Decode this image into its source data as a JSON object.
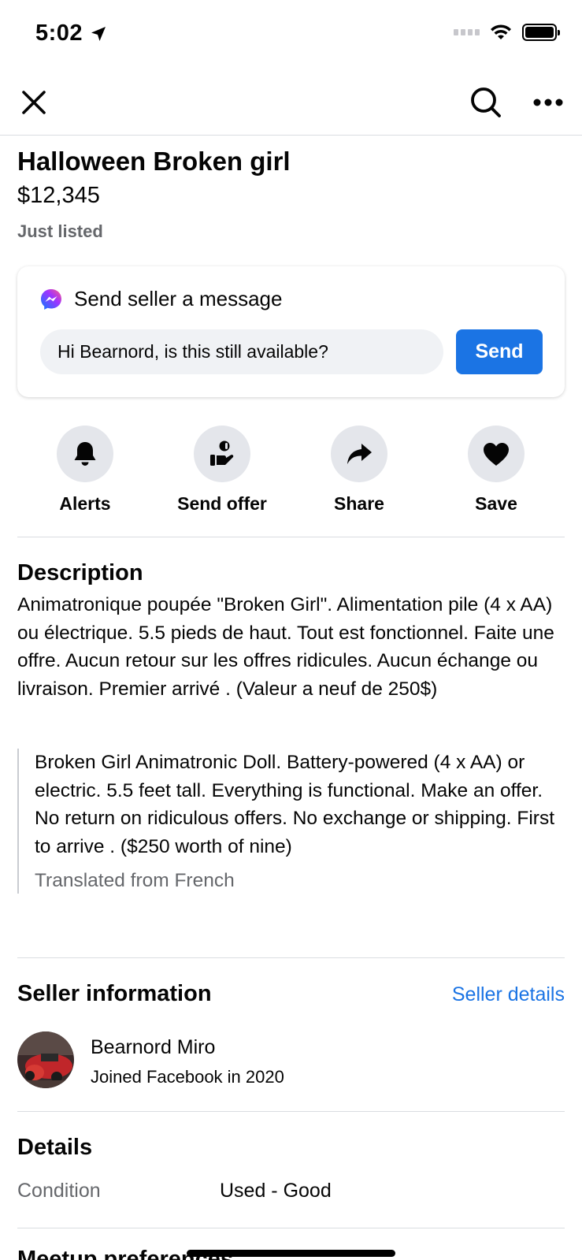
{
  "status_bar": {
    "time": "5:02"
  },
  "listing": {
    "title": "Halloween Broken girl",
    "price": "$12,345",
    "listed": "Just listed"
  },
  "message": {
    "heading": "Send seller a message",
    "input_value": "Hi Bearnord, is this still available?",
    "send_label": "Send"
  },
  "actions": {
    "alerts": "Alerts",
    "send_offer": "Send offer",
    "share": "Share",
    "save": "Save"
  },
  "description": {
    "heading": "Description",
    "text": "Animatronique poupée \"Broken Girl\". Alimentation pile (4 x AA) ou électrique. 5.5 pieds de haut. Tout est fonctionnel. Faite une offre. Aucun retour sur les offres ridicules. Aucun échange ou livraison. Premier arrivé . (Valeur a neuf de 250$)",
    "translation": "Broken Girl Animatronic Doll. Battery-powered (4 x AA) or electric. 5.5 feet tall. Everything is functional. Make an offer. No return on ridiculous offers. No exchange or shipping. First to arrive . ($250 worth of nine)",
    "translated_note": "Translated from French"
  },
  "seller": {
    "heading": "Seller information",
    "details_link": "Seller details",
    "name": "Bearnord Miro",
    "joined": "Joined Facebook in 2020"
  },
  "details": {
    "heading": "Details",
    "condition_label": "Condition",
    "condition_value": "Used - Good"
  },
  "next_section": {
    "heading": "Meetup preferences"
  },
  "colors": {
    "accent": "#1b74e4",
    "secondary_text": "#65676b",
    "button_bg": "#e4e6eb"
  }
}
